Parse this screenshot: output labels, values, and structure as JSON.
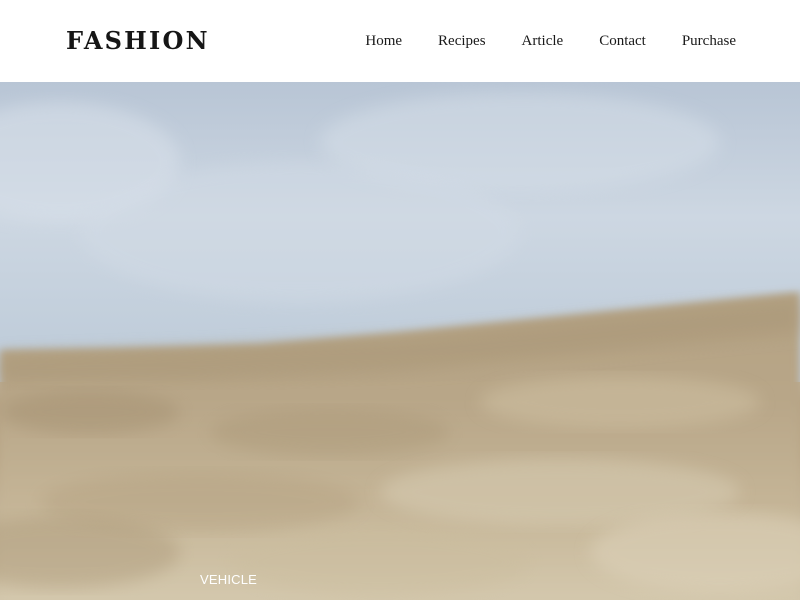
{
  "header": {
    "logo": "FASHION",
    "nav": [
      {
        "label": "Home"
      },
      {
        "label": "Recipes"
      },
      {
        "label": "Article"
      },
      {
        "label": "Contact"
      },
      {
        "label": "Purchase"
      }
    ]
  },
  "hero": {
    "caption": "VEHICLE",
    "image_subject": "blurred field of dry grass under a pale blue-grey sky"
  }
}
